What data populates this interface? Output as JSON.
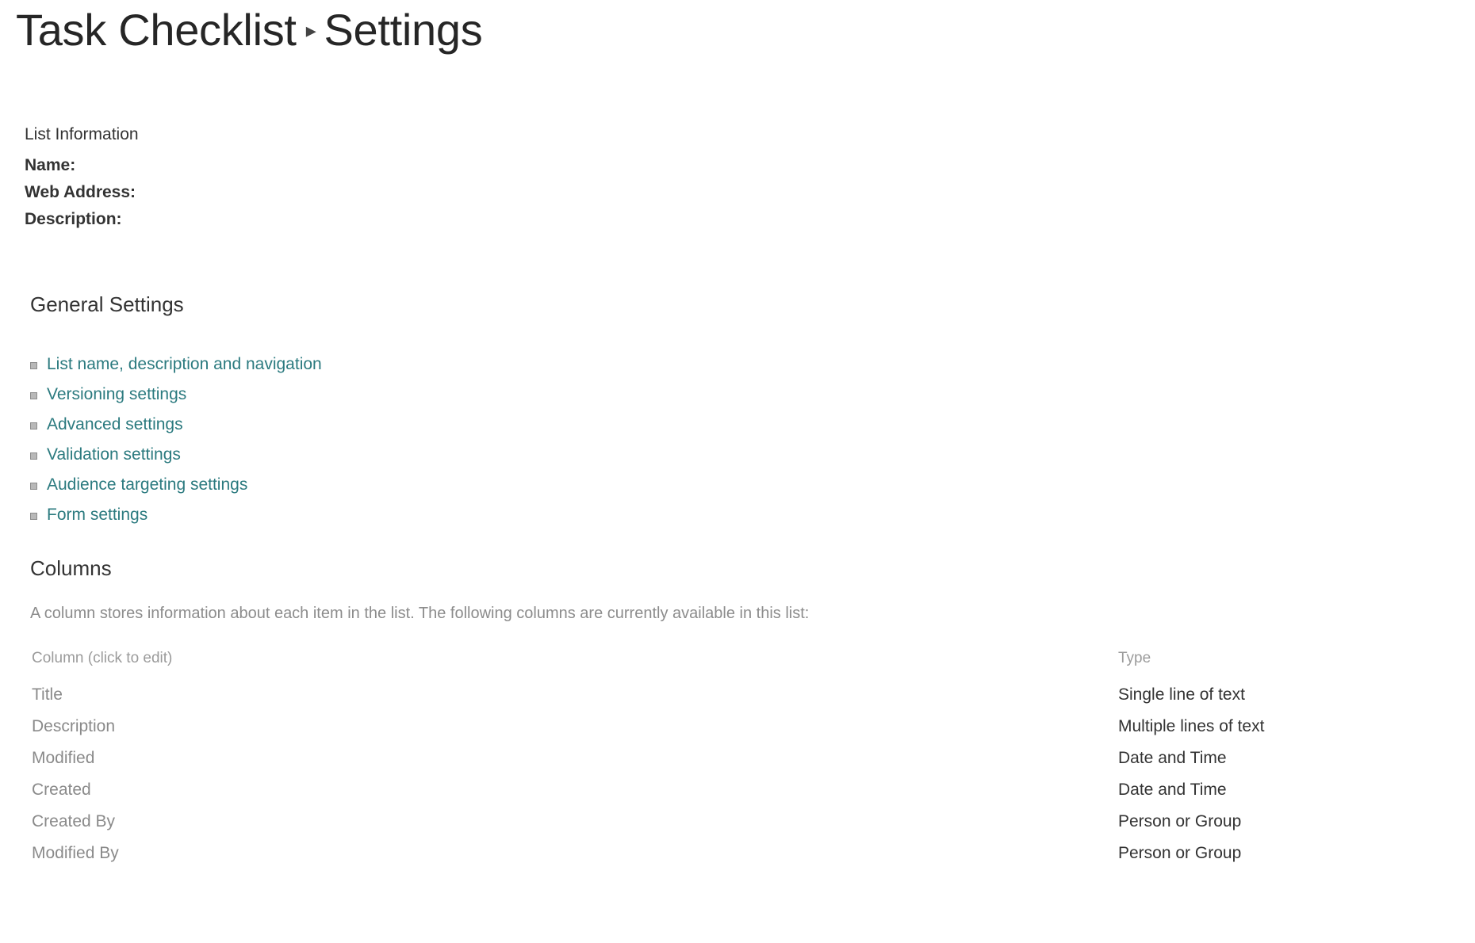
{
  "header": {
    "breadcrumb_parent": "Task Checklist",
    "breadcrumb_separator": "▸",
    "breadcrumb_current": "Settings"
  },
  "list_information": {
    "heading": "List Information",
    "fields": [
      {
        "label": "Name:",
        "value": ""
      },
      {
        "label": "Web Address:",
        "value": ""
      },
      {
        "label": "Description:",
        "value": ""
      }
    ]
  },
  "general_settings": {
    "heading": "General Settings",
    "links": [
      {
        "label": "List name, description and navigation"
      },
      {
        "label": "Versioning settings"
      },
      {
        "label": "Advanced settings"
      },
      {
        "label": "Validation settings"
      },
      {
        "label": "Audience targeting settings"
      },
      {
        "label": "Form settings"
      }
    ]
  },
  "columns_section": {
    "heading": "Columns",
    "description": "A column stores information about each item in the list. The following columns are currently available in this list:",
    "table_headers": {
      "column": "Column (click to edit)",
      "type": "Type"
    },
    "rows": [
      {
        "column": "Title",
        "type": "Single line of text"
      },
      {
        "column": "Description",
        "type": "Multiple lines of text"
      },
      {
        "column": "Modified",
        "type": "Date and Time"
      },
      {
        "column": "Created",
        "type": "Date and Time"
      },
      {
        "column": "Created By",
        "type": "Person or Group"
      },
      {
        "column": "Modified By",
        "type": "Person or Group"
      }
    ]
  },
  "colors": {
    "link": "#2b7a7f",
    "text": "#333333",
    "muted": "#8a8a8a",
    "bullet": "#b8b8b8",
    "background": "#ffffff"
  }
}
